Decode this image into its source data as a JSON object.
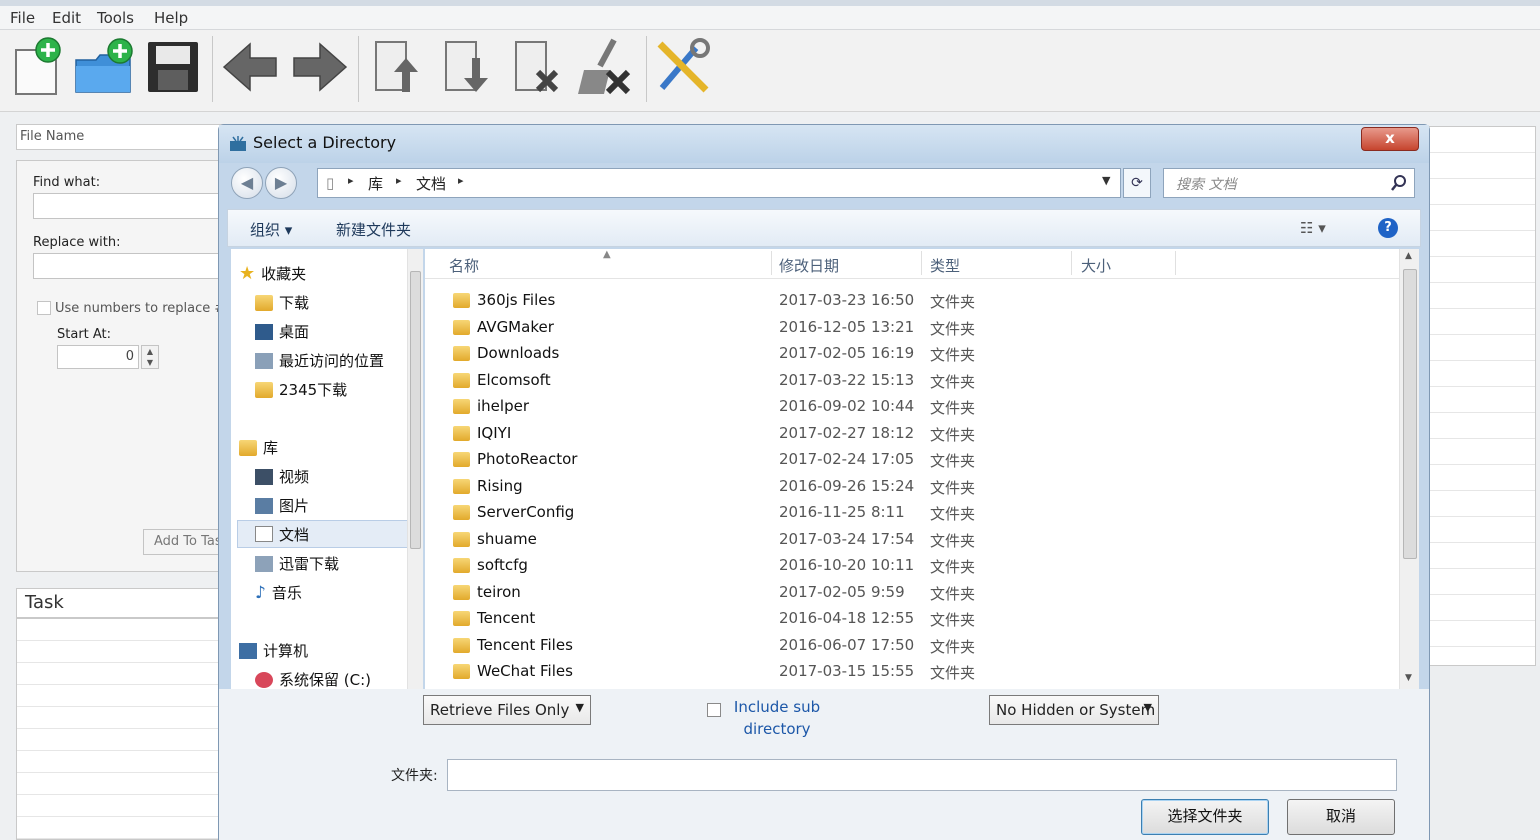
{
  "app": {
    "menu": [
      "File",
      "Edit",
      "Tools",
      "Help"
    ],
    "panel": {
      "file_name_header": "File Name",
      "find_label": "Find what:",
      "replace_label": "Replace with:",
      "use_numbers_label": "Use numbers to replace #'s",
      "start_at_label": "Start At:",
      "start_at_value": "0",
      "add_button": "Add To Task",
      "task_header": "Task"
    },
    "toolbar_icons": [
      "new-task-icon",
      "new-folder-icon",
      "save-icon",
      "back-arrow-icon",
      "forward-arrow-icon",
      "move-up-icon",
      "move-down-icon",
      "remove-icon",
      "clear-icon",
      "settings-tools-icon"
    ]
  },
  "dialog": {
    "title": "Select a Directory",
    "close_label": "x",
    "breadcrumb": [
      "库",
      "文档"
    ],
    "search_placeholder": "搜索 文档",
    "commands": {
      "organize": "组织 ▾",
      "new_folder": "新建文件夹"
    },
    "help_label": "?",
    "nav": {
      "favorites": {
        "header": "收藏夹",
        "items": [
          "下载",
          "桌面",
          "最近访问的位置",
          "2345下载"
        ]
      },
      "libraries": {
        "header": "库",
        "items": [
          "视频",
          "图片",
          "文档",
          "迅雷下载",
          "音乐"
        ],
        "selected": "文档"
      },
      "computer": {
        "header": "计算机",
        "items": [
          "系统保留 (C:)"
        ]
      }
    },
    "columns": {
      "name": "名称",
      "date": "修改日期",
      "type": "类型",
      "size": "大小"
    },
    "files": [
      {
        "name": "360js Files",
        "date": "2017-03-23 16:50",
        "type": "文件夹"
      },
      {
        "name": "AVGMaker",
        "date": "2016-12-05 13:21",
        "type": "文件夹"
      },
      {
        "name": "Downloads",
        "date": "2017-02-05 16:19",
        "type": "文件夹"
      },
      {
        "name": "Elcomsoft",
        "date": "2017-03-22 15:13",
        "type": "文件夹"
      },
      {
        "name": "ihelper",
        "date": "2016-09-02 10:44",
        "type": "文件夹"
      },
      {
        "name": "IQIYI",
        "date": "2017-02-27 18:12",
        "type": "文件夹"
      },
      {
        "name": "PhotoReactor",
        "date": "2017-02-24 17:05",
        "type": "文件夹"
      },
      {
        "name": "Rising",
        "date": "2016-09-26 15:24",
        "type": "文件夹"
      },
      {
        "name": "ServerConfig",
        "date": "2016-11-25 8:11",
        "type": "文件夹"
      },
      {
        "name": "shuame",
        "date": "2017-03-24 17:54",
        "type": "文件夹"
      },
      {
        "name": "softcfg",
        "date": "2016-10-20 10:11",
        "type": "文件夹"
      },
      {
        "name": "teiron",
        "date": "2017-02-05 9:59",
        "type": "文件夹"
      },
      {
        "name": "Tencent",
        "date": "2016-04-18 12:55",
        "type": "文件夹"
      },
      {
        "name": "Tencent Files",
        "date": "2016-06-07 17:50",
        "type": "文件夹"
      },
      {
        "name": "WeChat Files",
        "date": "2017-03-15 15:55",
        "type": "文件夹"
      }
    ],
    "options": {
      "retrieve": "Retrieve Files Only",
      "include_sub": "Include sub directory",
      "hidden": "No Hidden or System"
    },
    "folder_label": "文件夹:",
    "folder_value": "",
    "ok_button": "选择文件夹",
    "cancel_button": "取消"
  }
}
